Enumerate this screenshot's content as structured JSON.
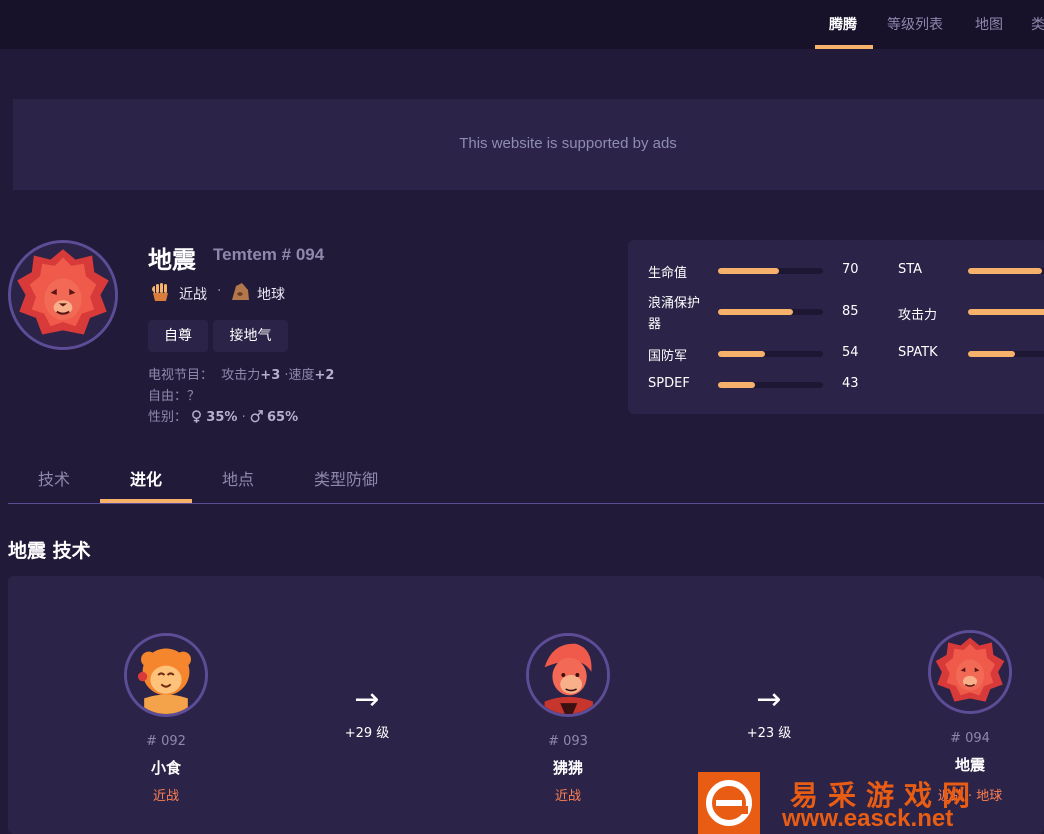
{
  "nav": {
    "items": [
      {
        "label": "腾腾",
        "active": true
      },
      {
        "label": "等级列表",
        "active": false
      },
      {
        "label": "地图",
        "active": false
      },
      {
        "label": "类",
        "active": false
      }
    ]
  },
  "ad": {
    "text": "This website is supported by ads"
  },
  "monster": {
    "name": "地震",
    "number": "Temtem # 094",
    "types": [
      {
        "label": "近战",
        "icon": "melee-fist-icon"
      },
      {
        "label": "地球",
        "icon": "earth-rock-icon"
      }
    ],
    "type_separator": "·",
    "traits": [
      "自尊",
      "接地气"
    ],
    "tv_label": "电视节目：",
    "tv_value_1": "攻击力",
    "tv_bold_1": "+3",
    "tv_value_2": "·速度",
    "tv_bold_2": "+2",
    "freedom": "自由：？",
    "gender_label": "性别：",
    "gender_female": "35%",
    "gender_sep": "·",
    "gender_male": "65%"
  },
  "stats": [
    {
      "name": "生命值",
      "value": "70",
      "fill": 0.58
    },
    {
      "name": "STA",
      "value": "",
      "fill": 0.7
    },
    {
      "name": "浪涌保护",
      "name2": "器",
      "value": "85",
      "fill": 0.71
    },
    {
      "name": "攻击力",
      "value": "",
      "fill": 1.0
    },
    {
      "name": "国防军",
      "value": "54",
      "fill": 0.45
    },
    {
      "name": "SPATK",
      "value": "",
      "fill": 0.45
    },
    {
      "name": "SPDEF",
      "value": "43",
      "fill": 0.35
    }
  ],
  "tabs": [
    {
      "label": "技术",
      "active": false
    },
    {
      "label": "进化",
      "active": true
    },
    {
      "label": "地点",
      "active": false
    },
    {
      "label": "类型防御",
      "active": false
    }
  ],
  "section_title": "地震 技术",
  "evolution": [
    {
      "number": "# 092",
      "name": "小食",
      "type": "近战"
    },
    {
      "number": "# 093",
      "name": "狒狒",
      "type": "近战"
    },
    {
      "number": "# 094",
      "name": "地震",
      "type": "近战 · 地球"
    }
  ],
  "evo_steps": [
    {
      "arrow": "→",
      "level": "+29 级"
    },
    {
      "arrow": "→",
      "level": "+23 级"
    }
  ],
  "watermark": {
    "title": "易采游戏网",
    "url": "www.easck.net"
  },
  "colors": {
    "accent": "#f6b26b",
    "background": "#211a39",
    "panel": "#2b2448",
    "type_melee": "#ff7f50"
  }
}
